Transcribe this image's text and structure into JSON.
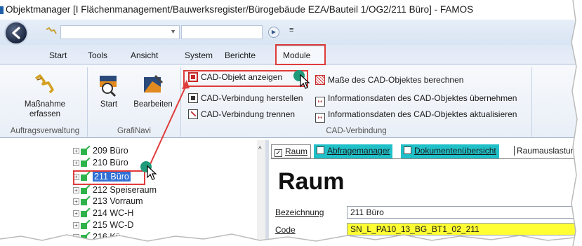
{
  "window": {
    "title": "Objektmanager [I   Flächenmanagement/Bauwerksregister/Bürogebäude EZA/Bauteil 1/OG2/211 Büro] - FAMOS"
  },
  "quick_access": {
    "combo1_value": "",
    "combo2_value": "",
    "more_symbol": "≡"
  },
  "tabs": [
    "Start",
    "Tools",
    "Ansicht",
    "System",
    "Berichte",
    "Module"
  ],
  "active_tab": "Module",
  "ribbon": {
    "groups": {
      "auftrag": {
        "label": "Auftragsverwaltung",
        "button": "Maßnahme erfassen"
      },
      "grafinavi": {
        "label": "GrafiNavi",
        "buttons": [
          "Start",
          "Bearbeiten"
        ]
      },
      "cad": {
        "label": "CAD-Verbindung",
        "left_buttons": [
          "CAD-Objekt anzeigen",
          "CAD-Verbindung herstellen",
          "CAD-Verbindung trennen"
        ],
        "right_buttons": [
          "Maße des CAD-Objektes berechnen",
          "Informationsdaten des CAD-Objektes übernehmen",
          "Informationsdaten des CAD-Objektes aktualisieren"
        ]
      }
    }
  },
  "tree": {
    "items": [
      {
        "label": "209 Büro",
        "selected": false
      },
      {
        "label": "210 Büro",
        "selected": false
      },
      {
        "label": "211 Büro",
        "selected": true
      },
      {
        "label": "212 Speiseraum",
        "selected": false
      },
      {
        "label": "213 Vorraum",
        "selected": false
      },
      {
        "label": "214 WC-H",
        "selected": false
      },
      {
        "label": "215 WC-D",
        "selected": false
      },
      {
        "label": "216 Kü",
        "selected": false
      }
    ]
  },
  "detail": {
    "tabs": [
      {
        "label": "Raum",
        "checked": true
      },
      {
        "label": "Abfragemanager",
        "checked": false
      },
      {
        "label": "Dokumentenübersicht",
        "checked": false
      },
      {
        "label": "Raumauslastun",
        "checked": false
      }
    ],
    "title": "Raum",
    "fields": [
      {
        "label": "Bezeichnung",
        "value": "211 Büro"
      },
      {
        "label": "Code",
        "value": "SN_L_PA10_13_BG_BT1_02_211"
      }
    ]
  },
  "colors": {
    "highlight_red": "#e03b3b",
    "selection_blue": "#2f6fd6",
    "code_field_yellow": "#ffff33",
    "tab_teal": "#20c0c8"
  }
}
